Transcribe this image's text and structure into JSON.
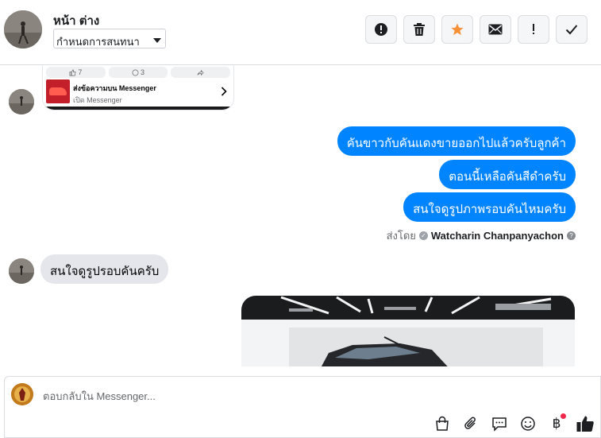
{
  "header": {
    "name": "หน้า ต่าง",
    "select_value": "กำหนดการสนทนา",
    "actions": [
      {
        "name": "spam-button",
        "icon": "exclamation-circle-icon"
      },
      {
        "name": "delete-button",
        "icon": "trash-icon"
      },
      {
        "name": "star-button",
        "icon": "star-icon",
        "color": "#f7923a"
      },
      {
        "name": "mark-unread-button",
        "icon": "envelope-icon"
      },
      {
        "name": "priority-button",
        "icon": "exclamation-icon"
      },
      {
        "name": "done-button",
        "icon": "check-icon"
      }
    ]
  },
  "share_card": {
    "likes": "7",
    "comments": "3",
    "title": "ส่งข้อความบน Messenger",
    "subtitle": "เปิด Messenger"
  },
  "messages_out": [
    "คันขาวกับคันแดงขายออกไปแล้วครับลูกค้า",
    "ตอนนี้เหลือคันสีดำครับ",
    "สนใจดูรูปภาพรอบคันไหมครับ"
  ],
  "sent_by": {
    "prefix": "ส่งโดย",
    "who": "Watcharin Chanpanyachon"
  },
  "message_in": "สนใจดูรูปรอบคันครับ",
  "composer": {
    "placeholder": "ตอบกลับใน Messenger..."
  },
  "colors": {
    "outgoing_bubble": "#0084ff",
    "incoming_bubble": "#e4e6eb",
    "star": "#f7923a"
  }
}
